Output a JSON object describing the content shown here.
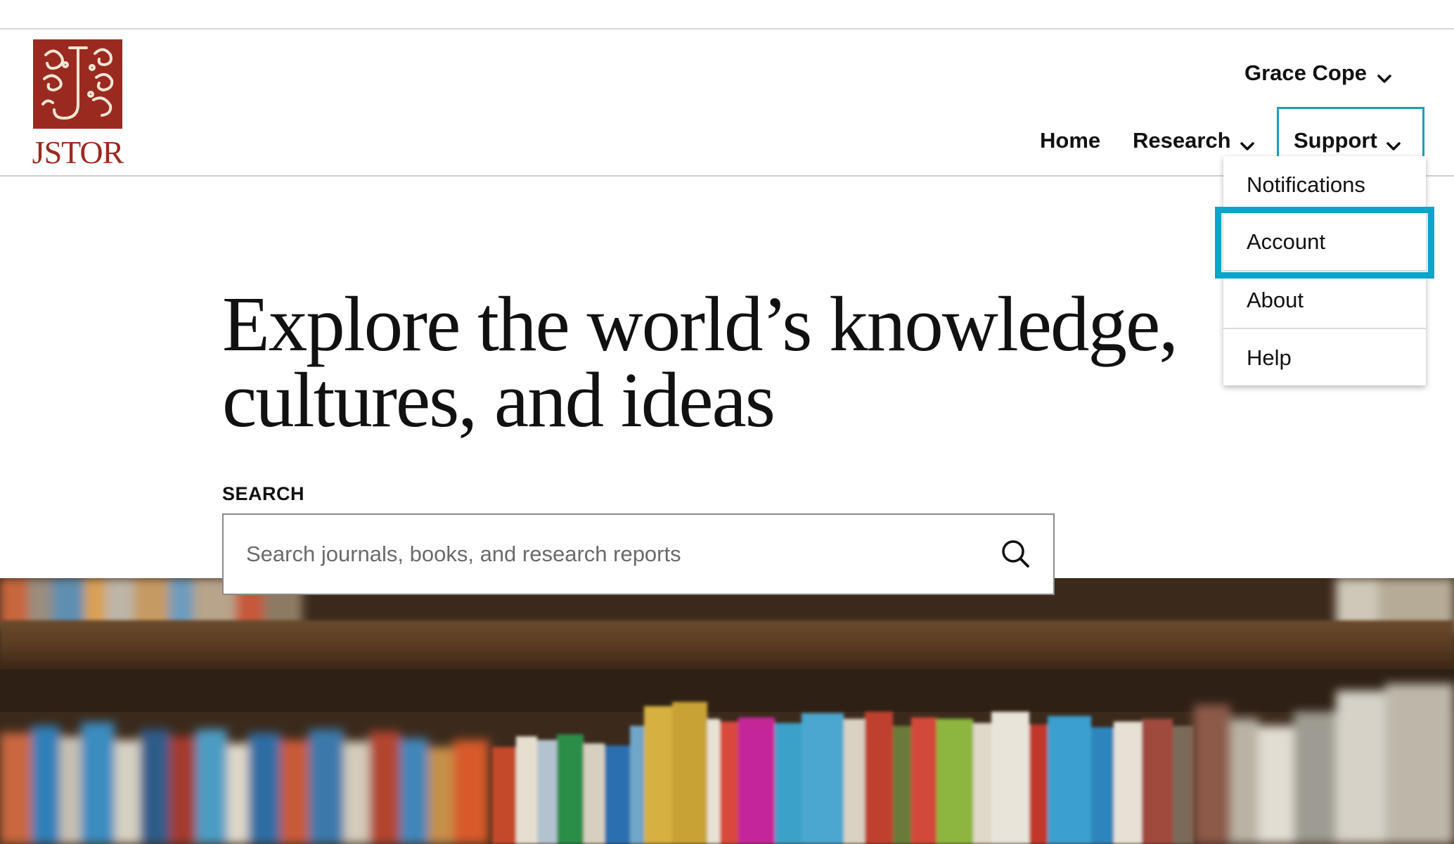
{
  "brand": {
    "name": "JSTOR",
    "seal_color": "#9a2a20"
  },
  "header": {
    "user_name": "Grace Cope",
    "nav": {
      "home": "Home",
      "research": "Research",
      "support": "Support"
    }
  },
  "support_menu": {
    "items": [
      "Notifications",
      "Account",
      "About",
      "Help"
    ],
    "highlighted": "Account",
    "highlight_color": "#0aa5c9"
  },
  "hero": {
    "headline_line1": "Explore the world’s knowledge,",
    "headline_line2": "cultures, and ideas"
  },
  "search": {
    "label": "SEARCH",
    "placeholder": "Search journals, books, and research reports",
    "icon": "search-icon"
  },
  "icons": [
    "chevron-down-icon",
    "search-icon"
  ],
  "hero_image": {
    "subject": "library-bookshelf-photo"
  }
}
